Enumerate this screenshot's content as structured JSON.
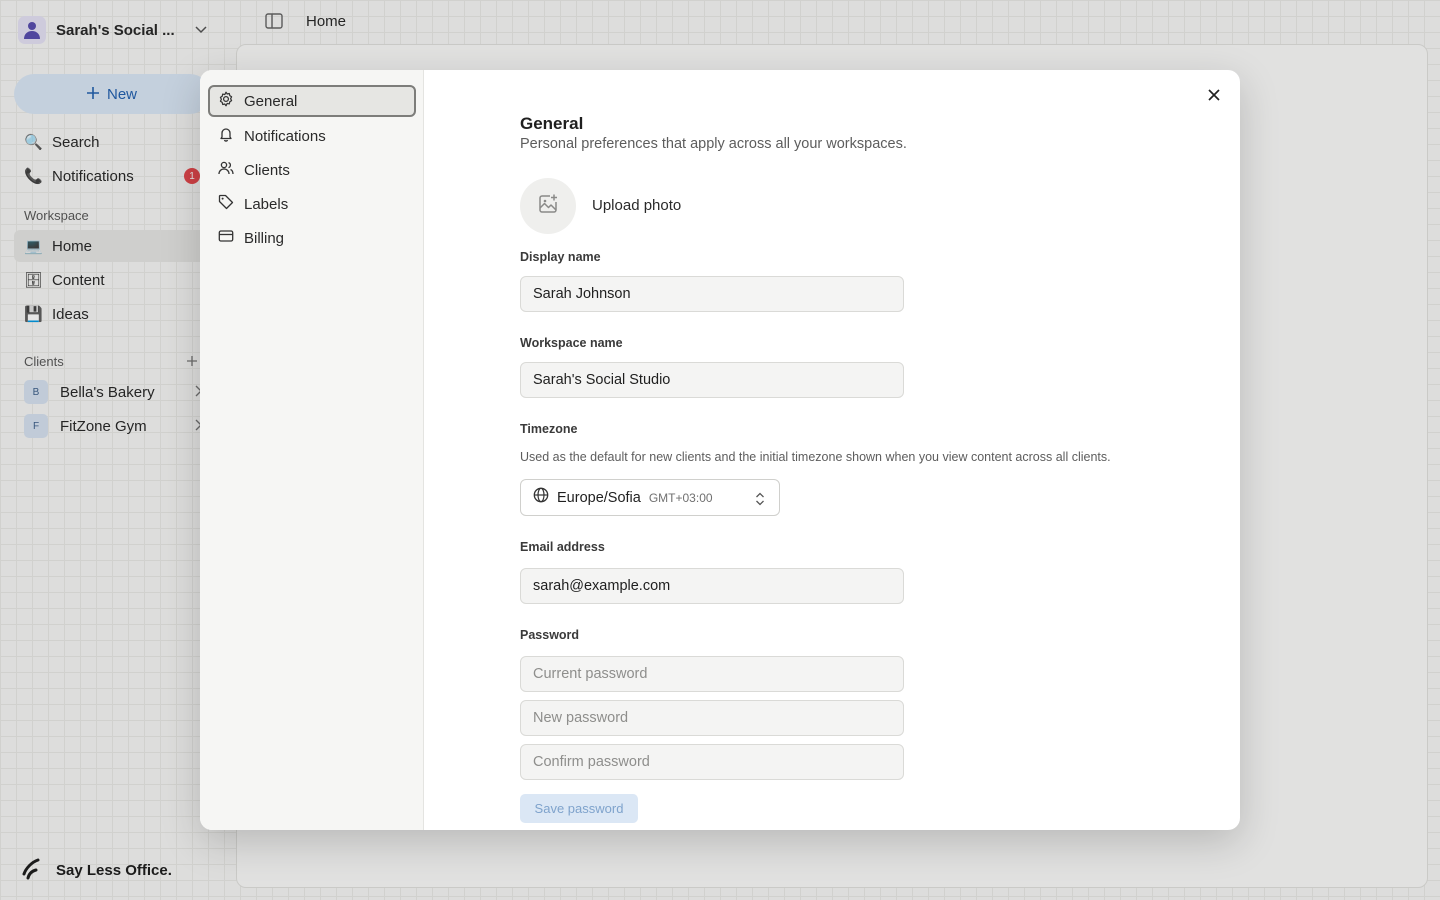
{
  "app": {
    "workspace_name": "Sarah's Social ...",
    "new_button": "New",
    "nav": {
      "search": "Search",
      "notifications": "Notifications",
      "notifications_count": "1"
    },
    "workspace_section": "Workspace",
    "workspace_items": [
      "Home",
      "Content",
      "Ideas"
    ],
    "clients_section": "Clients",
    "clients": [
      {
        "initial": "B",
        "name": "Bella's Bakery"
      },
      {
        "initial": "F",
        "name": "FitZone Gym"
      }
    ],
    "brand": "Say Less Office.",
    "topbar_title": "Home"
  },
  "modal": {
    "nav": [
      "General",
      "Notifications",
      "Clients",
      "Labels",
      "Billing"
    ],
    "active_nav": "General",
    "title": "General",
    "subtitle": "Personal preferences that apply across all your workspaces.",
    "upload_photo": "Upload photo",
    "display_name_label": "Display name",
    "display_name_value": "Sarah Johnson",
    "workspace_name_label": "Workspace name",
    "workspace_name_value": "Sarah's Social Studio",
    "timezone_label": "Timezone",
    "timezone_help": "Used as the default for new clients and the initial timezone shown when you view content across all clients.",
    "timezone_value": "Europe/Sofia",
    "timezone_offset": "GMT+03:00",
    "email_label": "Email address",
    "email_value": "sarah@example.com",
    "password_label": "Password",
    "current_password_placeholder": "Current password",
    "new_password_placeholder": "New password",
    "confirm_password_placeholder": "Confirm password",
    "save_password": "Save password"
  }
}
